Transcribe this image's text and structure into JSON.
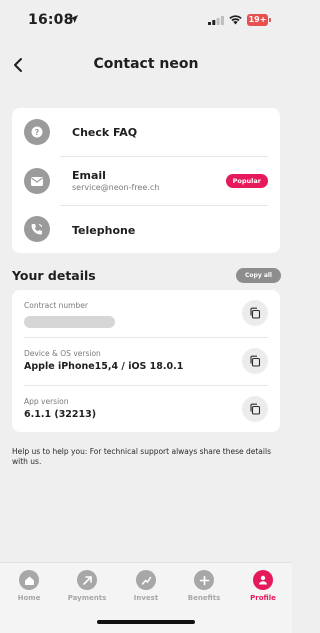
{
  "status_bar": {
    "time": "16:08",
    "battery": "19+"
  },
  "header": {
    "title": "Contact neon"
  },
  "contact": {
    "items": [
      {
        "label": "Check FAQ",
        "icon": "question-icon"
      },
      {
        "label": "Email",
        "sub": "service@neon-free.ch",
        "badge": "Popular",
        "icon": "mail-icon"
      },
      {
        "label": "Telephone",
        "icon": "phone-icon"
      }
    ]
  },
  "details": {
    "title": "Your details",
    "copy_all": "Copy all",
    "items": [
      {
        "label": "Contract number",
        "value": ""
      },
      {
        "label": "Device & OS version",
        "value": "Apple iPhone15,4 / iOS 18.0.1"
      },
      {
        "label": "App version",
        "value": "6.1.1 (32213)"
      }
    ],
    "help": "Help us to help you: For technical support always share these details with us."
  },
  "nav": {
    "items": [
      {
        "label": "Home",
        "icon": "home-icon"
      },
      {
        "label": "Payments",
        "icon": "payments-icon"
      },
      {
        "label": "Invest",
        "icon": "invest-icon"
      },
      {
        "label": "Benefits",
        "icon": "benefits-icon"
      },
      {
        "label": "Profile",
        "icon": "profile-icon",
        "active": true
      }
    ]
  },
  "colors": {
    "accent": "#e6195a",
    "background": "#efefef",
    "card": "#ffffff",
    "muted": "#a7a7a7"
  }
}
